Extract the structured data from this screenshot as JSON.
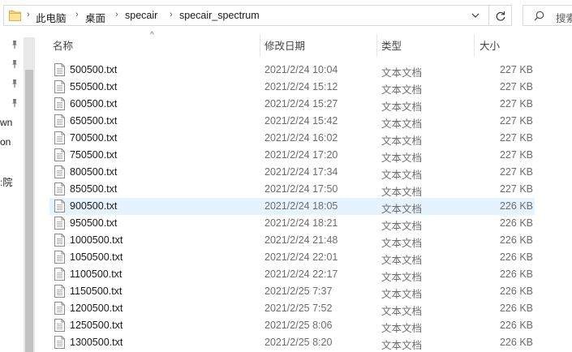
{
  "address": {
    "breadcrumbs": [
      "此电脑",
      "桌面",
      "specair",
      "specair_spectrum"
    ],
    "search_placeholder": "搜索"
  },
  "nav": {
    "partial_items": [
      "wn",
      "on",
      ":院"
    ]
  },
  "columns": {
    "name": "名称",
    "date": "修改日期",
    "type": "类型",
    "size": "大小"
  },
  "files": [
    {
      "name": "500500.txt",
      "date": "2021/2/24 10:04",
      "type": "文本文档",
      "size": "227 KB"
    },
    {
      "name": "550500.txt",
      "date": "2021/2/24 15:12",
      "type": "文本文档",
      "size": "227 KB"
    },
    {
      "name": "600500.txt",
      "date": "2021/2/24 15:27",
      "type": "文本文档",
      "size": "227 KB"
    },
    {
      "name": "650500.txt",
      "date": "2021/2/24 15:42",
      "type": "文本文档",
      "size": "227 KB"
    },
    {
      "name": "700500.txt",
      "date": "2021/2/24 16:02",
      "type": "文本文档",
      "size": "227 KB"
    },
    {
      "name": "750500.txt",
      "date": "2021/2/24 17:20",
      "type": "文本文档",
      "size": "227 KB"
    },
    {
      "name": "800500.txt",
      "date": "2021/2/24 17:34",
      "type": "文本文档",
      "size": "227 KB"
    },
    {
      "name": "850500.txt",
      "date": "2021/2/24 17:50",
      "type": "文本文档",
      "size": "227 KB"
    },
    {
      "name": "900500.txt",
      "date": "2021/2/24 18:05",
      "type": "文本文档",
      "size": "226 KB"
    },
    {
      "name": "950500.txt",
      "date": "2021/2/24 18:21",
      "type": "文本文档",
      "size": "226 KB"
    },
    {
      "name": "1000500.txt",
      "date": "2021/2/24 21:48",
      "type": "文本文档",
      "size": "226 KB"
    },
    {
      "name": "1050500.txt",
      "date": "2021/2/24 22:01",
      "type": "文本文档",
      "size": "226 KB"
    },
    {
      "name": "1100500.txt",
      "date": "2021/2/24 22:17",
      "type": "文本文档",
      "size": "226 KB"
    },
    {
      "name": "1150500.txt",
      "date": "2021/2/25 7:37",
      "type": "文本文档",
      "size": "226 KB"
    },
    {
      "name": "1200500.txt",
      "date": "2021/2/25 7:52",
      "type": "文本文档",
      "size": "226 KB"
    },
    {
      "name": "1250500.txt",
      "date": "2021/2/25 8:06",
      "type": "文本文档",
      "size": "226 KB"
    },
    {
      "name": "1300500.txt",
      "date": "2021/2/25 8:20",
      "type": "文本文档",
      "size": "226 KB"
    }
  ],
  "selected_file": "900500.txt",
  "colors": {
    "selection": "#e5f3ff",
    "folder": "#f8d775",
    "secondary_text": "#6d6d6d"
  }
}
